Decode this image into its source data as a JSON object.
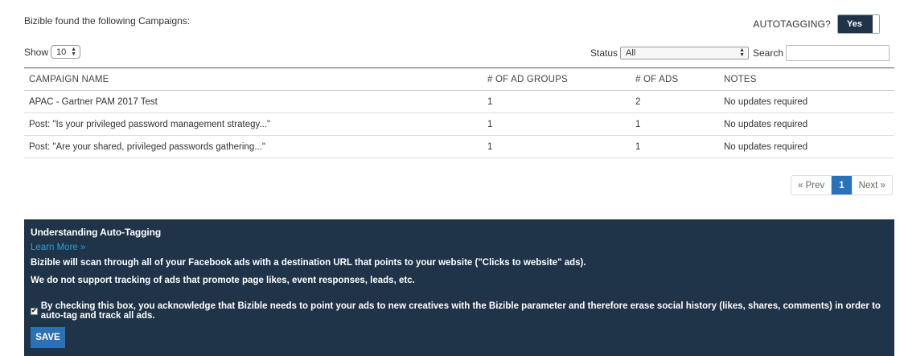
{
  "header": {
    "found_text": "Bizible found the following Campaigns:",
    "autotagging_label": "AUTOTAGGING?",
    "autotagging_value": "Yes"
  },
  "controls": {
    "show_label": "Show",
    "show_value": "10",
    "status_label": "Status",
    "status_value": "All",
    "search_label": "Search",
    "search_value": ""
  },
  "table": {
    "headers": [
      "CAMPAIGN NAME",
      "# OF AD GROUPS",
      "# OF ADS",
      "NOTES"
    ],
    "rows": [
      {
        "name": "APAC - Gartner PAM 2017 Test",
        "ad_groups": "1",
        "ads": "2",
        "notes": "No updates required"
      },
      {
        "name": "Post: \"Is your privileged password management strategy...\"",
        "ad_groups": "1",
        "ads": "1",
        "notes": "No updates required"
      },
      {
        "name": "Post: \"Are your shared, privileged passwords gathering...\"",
        "ad_groups": "1",
        "ads": "1",
        "notes": "No updates required"
      }
    ]
  },
  "pagination": {
    "prev": "« Prev",
    "current": "1",
    "next": "Next »"
  },
  "info": {
    "title": "Understanding Auto-Tagging",
    "learn_more": "Learn More »",
    "line1": "Bizible will scan through all of your Facebook ads with a destination URL that points to your website (\"Clicks to website\" ads).",
    "line2": "We do not support tracking of ads that promote page likes, event responses, leads, etc.",
    "acknowledge": "By checking this box, you acknowledge that Bizible needs to point your ads to new creatives with the Bizible parameter and therefore erase social history (likes, shares, comments) in order to auto-tag and track all ads.",
    "acknowledge_checked": true,
    "save": "SAVE"
  },
  "colors": {
    "panel_bg": "#1f3349",
    "accent_blue": "#2a72b5",
    "link_teal": "#2aa1b5",
    "link_blue": "#2f9fd8"
  }
}
